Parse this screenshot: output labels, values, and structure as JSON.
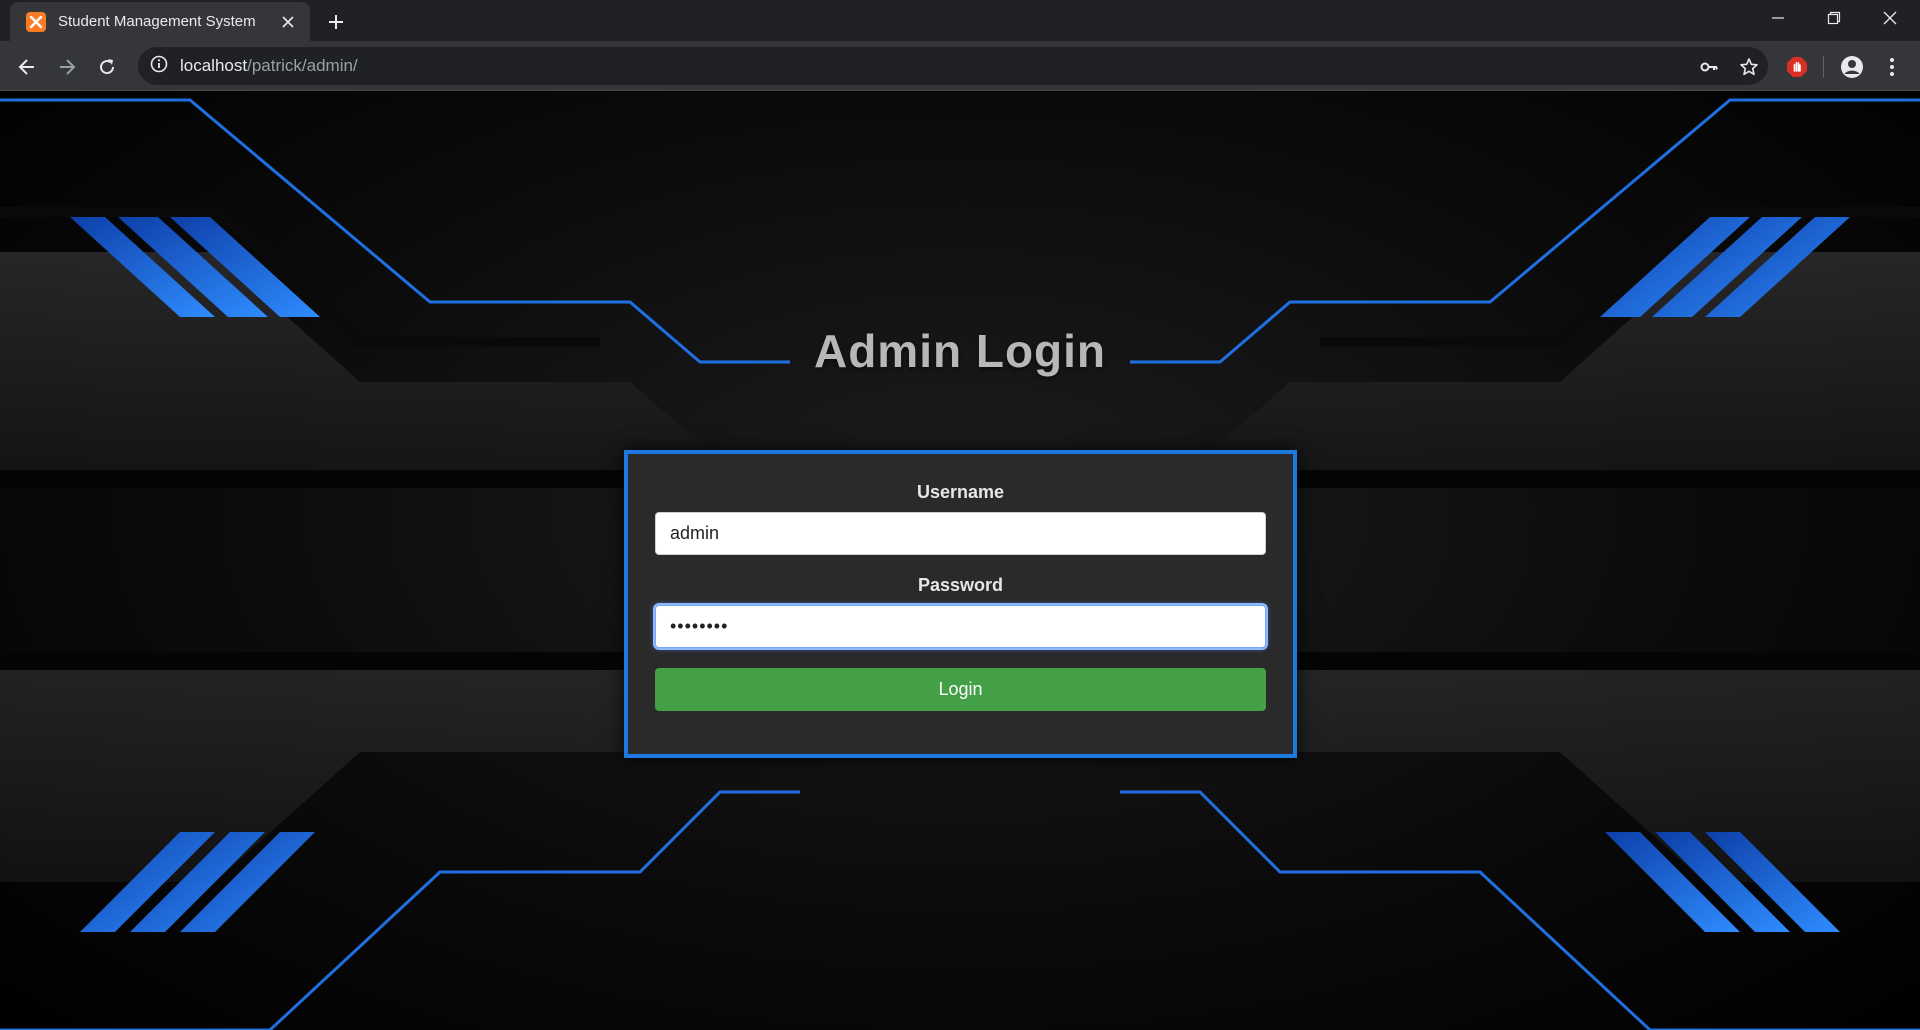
{
  "browser": {
    "tab_title": "Student Management System",
    "url_host": "localhost",
    "url_path": "/patrick/admin/",
    "accent_colors": {
      "favicon": "#fb7a24",
      "extension": "#d93025"
    }
  },
  "page": {
    "title": "Admin Login",
    "username_label": "Username",
    "username_value": "admin",
    "password_label": "Password",
    "password_value": "••••••••",
    "login_label": "Login",
    "colors": {
      "card_border": "#1d79e0",
      "login_button": "#43a047",
      "title": "#b7b7b7"
    }
  }
}
